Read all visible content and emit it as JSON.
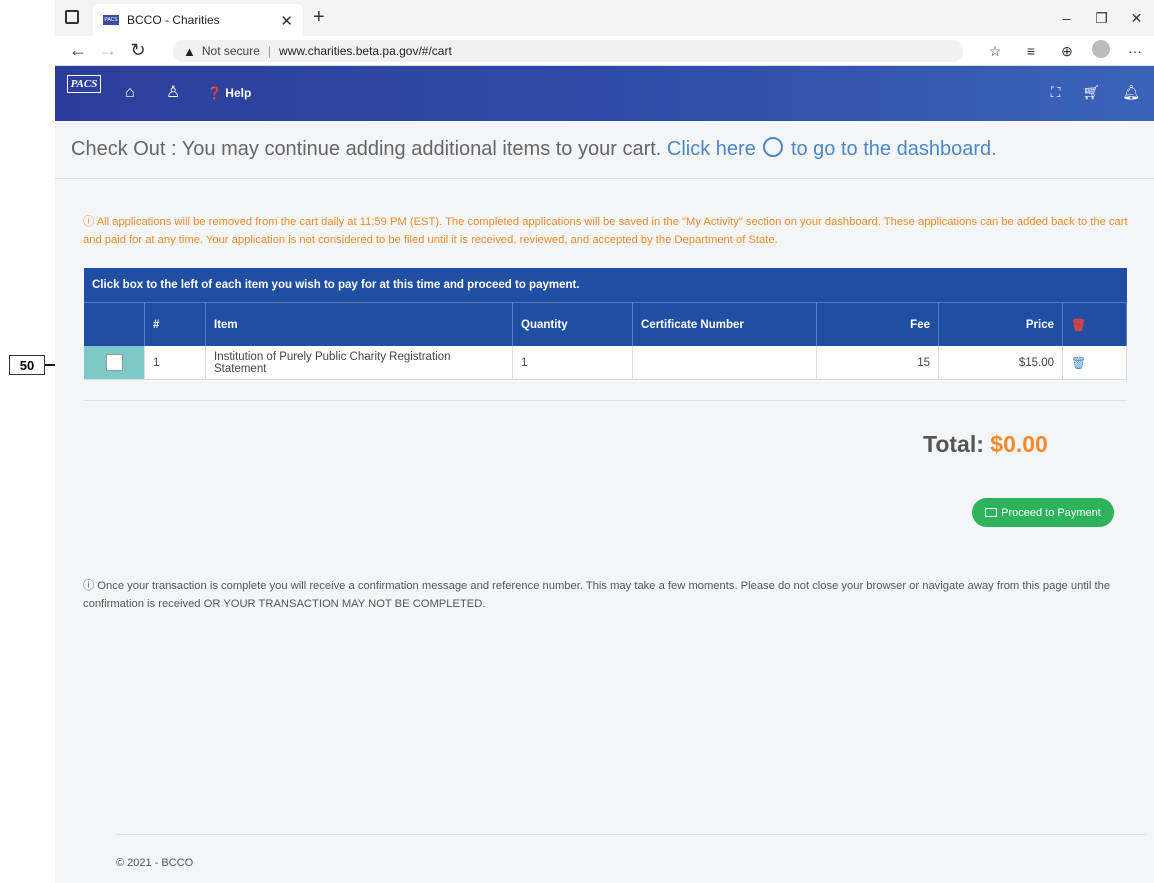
{
  "annotation": {
    "label": "50"
  },
  "browser": {
    "tab_title": "BCCO - Charities",
    "tab_favicon": "PACS",
    "security_label": "Not secure",
    "url": "www.charities.beta.pa.gov/#/cart"
  },
  "appnav": {
    "logo": "PACS",
    "help_label": "Help"
  },
  "page": {
    "heading_prefix": "Check Out : You may continue adding additional items to your cart. ",
    "heading_link1": "Click here",
    "heading_link2": " to go to the dashboard."
  },
  "notice": "All applications will be removed from the cart daily at 11:59 PM (EST). The completed applications will be saved in the \"My Activity\" section on your dashboard. These applications can be added back to the cart and paid for at any time. Your application is not considered to be filed until it is received, reviewed, and accepted by the Department of State.",
  "table": {
    "title": "Click box to the left of each item you wish to pay for at this time and proceed to payment.",
    "headers": {
      "num": "#",
      "item": "Item",
      "quantity": "Quantity",
      "certificate": "Certificate Number",
      "fee": "Fee",
      "price": "Price"
    },
    "rows": [
      {
        "num": "1",
        "item": "Institution of Purely Public Charity Registration Statement",
        "quantity": "1",
        "certificate": "",
        "fee": "15",
        "price": "$15.00",
        "checked": false
      }
    ]
  },
  "total": {
    "label": "Total: ",
    "amount": "$0.00"
  },
  "pay_button": "Proceed to Payment",
  "confirm_text": "Once your transaction is complete you will receive a confirmation message and reference number. This may take a few moments. Please do not close your browser or navigate away from this page until the confirmation is received OR YOUR TRANSACTION MAY NOT BE COMPLETED.",
  "footer": "© 2021 - BCCO",
  "colors": {
    "nav": "#2c3e9a",
    "table_header": "#1f4ea3",
    "accent_orange": "#f08a2a",
    "button_green": "#2db35b",
    "checkbox_cell": "#7dc9c9"
  },
  "icons": [
    "home-icon",
    "user-icon",
    "help-icon",
    "binoculars-icon",
    "cart-icon",
    "bell-icon",
    "clock-icon",
    "trash-icon",
    "card-icon",
    "info-icon"
  ]
}
